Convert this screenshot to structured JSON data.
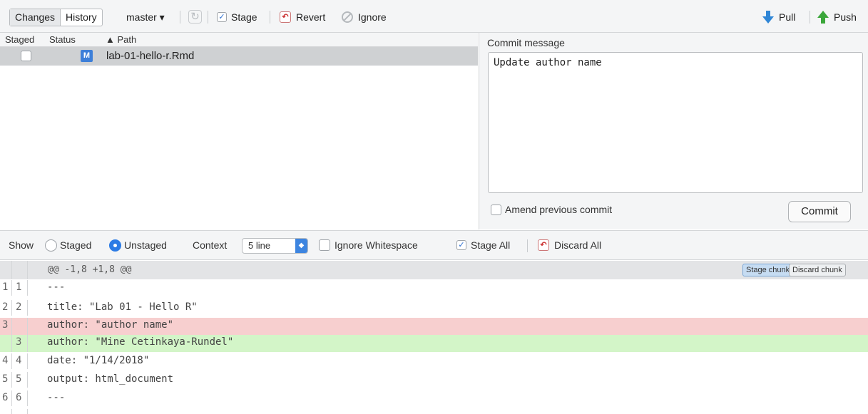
{
  "toolbar": {
    "tabs": [
      "Changes",
      "History"
    ],
    "branch": "master ▾",
    "stage_label": "Stage",
    "revert_label": "Revert",
    "ignore_label": "Ignore",
    "pull_label": "Pull",
    "push_label": "Push"
  },
  "files": {
    "columns": {
      "staged": "Staged",
      "status": "Status",
      "path": "▲ Path"
    },
    "rows": [
      {
        "staged": false,
        "status": "M",
        "path": "lab-01-hello-r.Rmd"
      }
    ]
  },
  "commit": {
    "label": "Commit message",
    "message": "Update author name",
    "amend_label": "Amend previous commit",
    "button": "Commit"
  },
  "diff_options": {
    "show_label": "Show",
    "staged_label": "Staged",
    "unstaged_label": "Unstaged",
    "selected": "Unstaged",
    "context_label": "Context",
    "context_value": "5 line",
    "ignore_ws_label": "Ignore Whitespace",
    "stage_all_label": "Stage All",
    "discard_all_label": "Discard All"
  },
  "hunk": {
    "header": "@@ -1,8 +1,8 @@",
    "stage_chunk": "Stage chunk",
    "discard_chunk": "Discard chunk"
  },
  "diff_lines": [
    {
      "old": "1",
      "new": "1",
      "type": "context",
      "text": "---"
    },
    {
      "old": "2",
      "new": "2",
      "type": "context",
      "text": "title: \"Lab 01 - Hello R\""
    },
    {
      "old": "3",
      "new": "",
      "type": "del",
      "text": "author: \"author name\""
    },
    {
      "old": "",
      "new": "3",
      "type": "add",
      "text": "author: \"Mine Cetinkaya-Rundel\""
    },
    {
      "old": "4",
      "new": "4",
      "type": "context",
      "text": "date: \"1/14/2018\""
    },
    {
      "old": "5",
      "new": "5",
      "type": "context",
      "text": "output: html_document"
    },
    {
      "old": "6",
      "new": "6",
      "type": "context",
      "text": "---"
    }
  ],
  "colors": {
    "pull_arrow": "#2f86d6",
    "push_arrow": "#3aa63a",
    "status_modified": "#3d7fd9",
    "deleted_line": "#f7cfcf",
    "added_line": "#d3f5c8"
  }
}
